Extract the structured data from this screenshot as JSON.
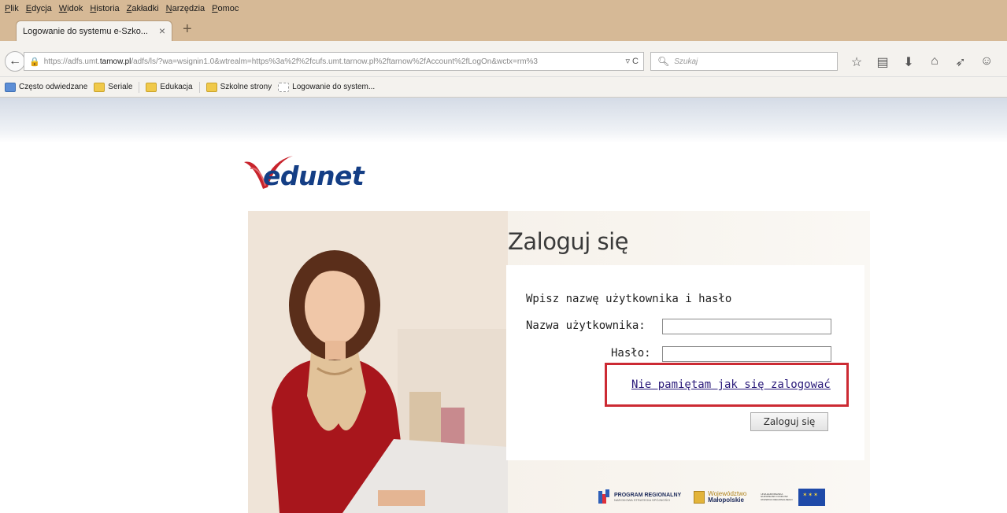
{
  "browser": {
    "menu": [
      "Plik",
      "Edycja",
      "Widok",
      "Historia",
      "Zakładki",
      "Narzędzia",
      "Pomoc"
    ],
    "tab": {
      "title": "Logowanie do systemu e-Szko...",
      "close": "×"
    },
    "new_tab": "+",
    "url": {
      "prefix": "https://adfs.umt.",
      "host": "tamow.pl",
      "rest": "/adfs/ls/?wa=wsignin1.0&wtrealm=https%3a%2f%2fcufs.umt.tarnow.pl%2ftarnow%2fAccount%2fLogOn&wctx=rm%3",
      "actions": "▿ C"
    },
    "search_placeholder": "Szukaj",
    "bookmarks": [
      "Często odwiedzane",
      "Seriale",
      "Edukacja",
      "Szkolne strony",
      "Logowanie do system..."
    ]
  },
  "page": {
    "logo": "edunet",
    "title": "Zaloguj się",
    "prompt": "Wpisz nazwę użytkownika i hasło",
    "username_label": "Nazwa użytkownika:",
    "password_label": "Hasło:",
    "username_value": "",
    "password_value": "",
    "forgot_link": "Nie pamiętam jak się zalogować",
    "submit": "Zaloguj się",
    "footer": {
      "program": "PROGRAM REGIONALNY",
      "program_sub": "NARODOWA STRATEGIA SPÓJNOŚCI",
      "wojewodztwo": "Województwo",
      "malopolskie": "Małopolskie",
      "eu_text": "UNIA EUROPEJSKA EUROPEJSKI FUNDUSZ ROZWOJU REGIONALNEGO"
    }
  },
  "colors": {
    "chrome": "#d6b996",
    "highlight": "#cc2a33",
    "logo": "#143e85",
    "link": "#2a1a7a"
  }
}
